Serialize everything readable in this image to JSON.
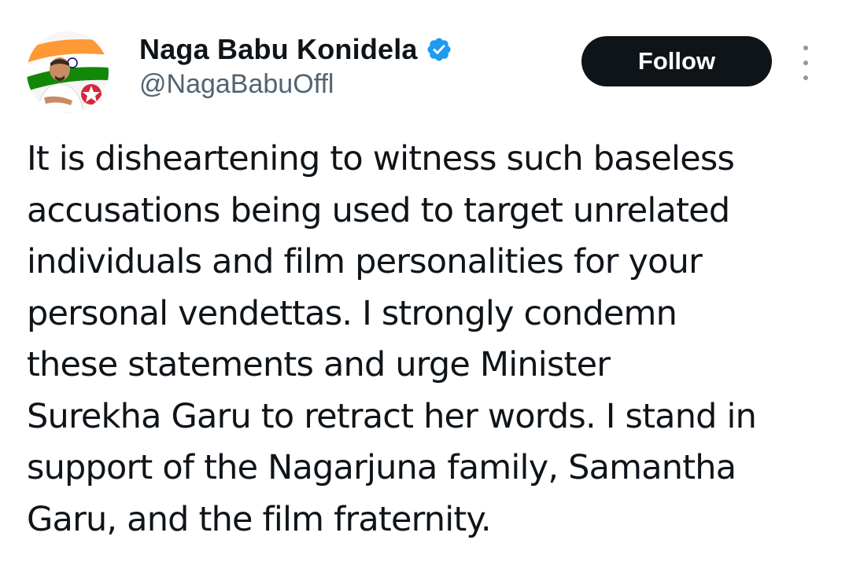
{
  "author": {
    "display_name": "Naga Babu Konidela",
    "handle": "@NagaBabuOffl",
    "verified": true,
    "avatar_icon": "profile-photo-with-tricolor-flag-and-party-logo"
  },
  "actions": {
    "follow_label": "Follow",
    "more_icon": "vertical-ellipsis-icon"
  },
  "tweet": {
    "text": "It is disheartening to witness such baseless\naccusations being used to target unrelated\nindividuals and film personalities for your\npersonal vendettas. I strongly condemn\nthese statements and urge Minister\nSurekha Garu to retract her words. I stand in\nsupport of the Nagarjuna family, Samantha\nGaru, and the film fraternity."
  },
  "colors": {
    "follow_button_bg": "#0f1419",
    "follow_button_text": "#ffffff",
    "verified_badge": "#1d9bf0",
    "handle_text": "#536471",
    "body_text": "#0f1419"
  }
}
